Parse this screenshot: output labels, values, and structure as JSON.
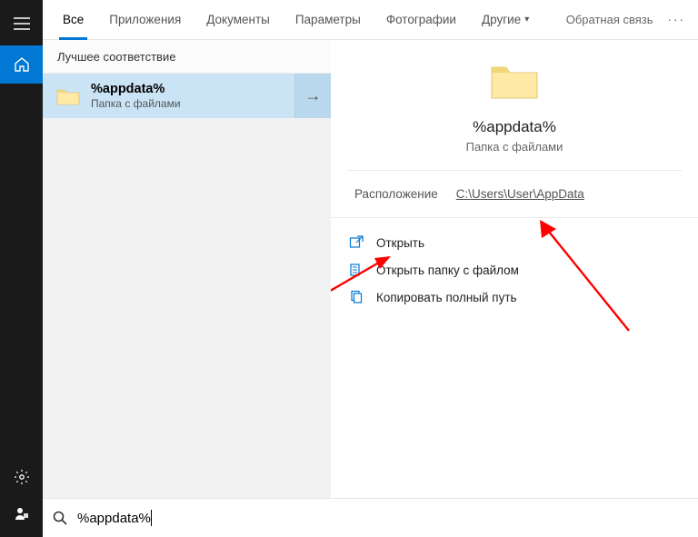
{
  "tabs": {
    "all": "Все",
    "apps": "Приложения",
    "documents": "Документы",
    "settings": "Параметры",
    "photos": "Фотографии",
    "more": "Другие"
  },
  "feedback": "Обратная связь",
  "results": {
    "section_header": "Лучшее соответствие",
    "item": {
      "title": "%appdata%",
      "subtitle": "Папка с файлами"
    }
  },
  "preview": {
    "title": "%appdata%",
    "subtitle": "Папка с файлами",
    "location_label": "Расположение",
    "location_path": "C:\\Users\\User\\AppData",
    "actions": {
      "open": "Открыть",
      "open_folder": "Открыть папку с файлом",
      "copy_path": "Копировать полный путь"
    }
  },
  "search": {
    "value": "%appdata%"
  }
}
